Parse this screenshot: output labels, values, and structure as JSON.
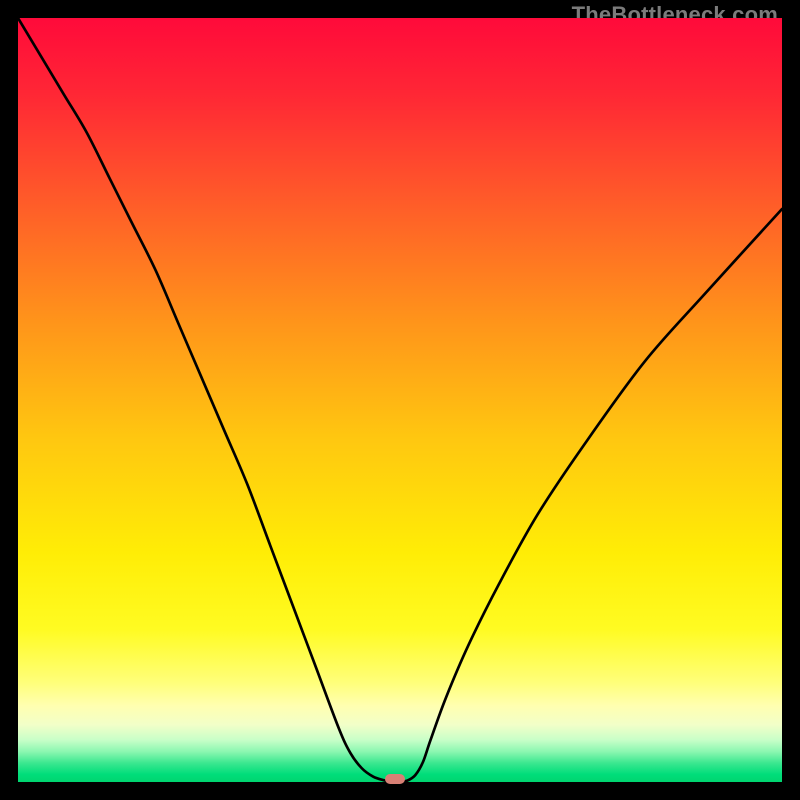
{
  "watermark": "TheBottleneck.com",
  "chart_data": {
    "type": "line",
    "title": "",
    "xlabel": "",
    "ylabel": "",
    "xlim": [
      0,
      100
    ],
    "ylim": [
      0,
      100
    ],
    "x": [
      0,
      3,
      6,
      9,
      12,
      15,
      18,
      21,
      24,
      27,
      30,
      33,
      36,
      39,
      42,
      43.5,
      45,
      46.5,
      48,
      49,
      50,
      51,
      52,
      53,
      54,
      56,
      59,
      63,
      68,
      74,
      82,
      90,
      100
    ],
    "y": [
      100,
      95,
      90,
      85,
      79,
      73,
      67,
      60,
      53,
      46,
      39,
      31,
      23,
      15,
      7,
      3.8,
      1.8,
      0.7,
      0.2,
      0.0,
      0.0,
      0.2,
      0.9,
      2.6,
      5.5,
      11,
      18,
      26,
      35,
      44,
      55,
      64,
      75
    ],
    "minimum_point": {
      "x": 49.3,
      "y": 0.0
    },
    "background_gradient_stops": [
      {
        "offset": 0.0,
        "color": "#ff0a3a"
      },
      {
        "offset": 0.1,
        "color": "#ff2735"
      },
      {
        "offset": 0.25,
        "color": "#ff5f28"
      },
      {
        "offset": 0.4,
        "color": "#ff951a"
      },
      {
        "offset": 0.55,
        "color": "#ffc710"
      },
      {
        "offset": 0.7,
        "color": "#ffed06"
      },
      {
        "offset": 0.8,
        "color": "#fffb22"
      },
      {
        "offset": 0.87,
        "color": "#ffff7a"
      },
      {
        "offset": 0.9,
        "color": "#ffffb0"
      },
      {
        "offset": 0.925,
        "color": "#f2ffc8"
      },
      {
        "offset": 0.945,
        "color": "#c8ffc8"
      },
      {
        "offset": 0.96,
        "color": "#8cf7b1"
      },
      {
        "offset": 0.975,
        "color": "#3ce890"
      },
      {
        "offset": 0.99,
        "color": "#00dd7a"
      },
      {
        "offset": 1.0,
        "color": "#00d570"
      }
    ]
  }
}
